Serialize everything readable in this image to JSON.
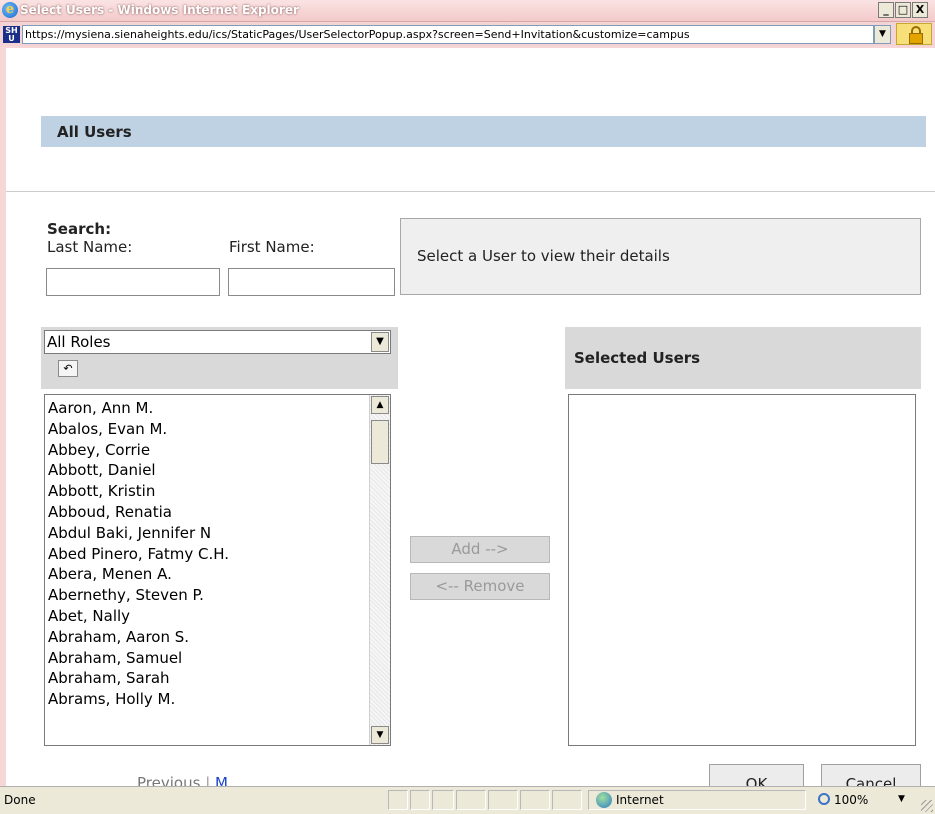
{
  "window": {
    "title": "Select Users - Windows Internet Explorer",
    "minimize_glyph": "_",
    "maximize_glyph": "□",
    "close_glyph": "X"
  },
  "address_bar": {
    "site_icon_text": "SH U",
    "url": "https://mysiena.sienaheights.edu/ics/StaticPages/UserSelectorPopup.aspx?screen=Send+Invitation&customize=campus"
  },
  "page": {
    "header_title": "All Users",
    "search": {
      "heading": "Search:",
      "last_name_label": "Last Name:",
      "first_name_label": "First Name:",
      "last_name_value": "",
      "first_name_value": ""
    },
    "details_text": "Select a User to view their details",
    "roles_select": {
      "selected": "All Roles",
      "arrow": "▼"
    },
    "reset_icon": "↶",
    "users": [
      "Aaron, Ann M.",
      "Abalos, Evan M.",
      "Abbey, Corrie",
      "Abbott, Daniel",
      "Abbott, Kristin",
      "Abboud, Renatia",
      "Abdul Baki, Jennifer N",
      "Abed Pinero, Fatmy C.H.",
      "Abera, Menen A.",
      "Abernethy, Steven P.",
      "Abet, Nally",
      "Abraham, Aaron S.",
      "Abraham, Samuel",
      "Abraham, Sarah",
      "Abrams, Holly M."
    ],
    "add_button": "Add -->",
    "remove_button": "<-- Remove",
    "selected_users_title": "Selected Users",
    "selected_users": [],
    "pagination": {
      "previous": "Previous",
      "separator": "|",
      "next": "M"
    },
    "ok_button": "OK",
    "cancel_button": "Cancel"
  },
  "status_bar": {
    "status": "Done",
    "zone": "Internet",
    "zoom": "100%"
  },
  "colors": {
    "window_frame": "#f6d6d6",
    "header_bar": "#bfd2e4",
    "panel_gray": "#d9d9d9",
    "details_bg": "#efefef",
    "link_blue": "#1b45c8"
  }
}
